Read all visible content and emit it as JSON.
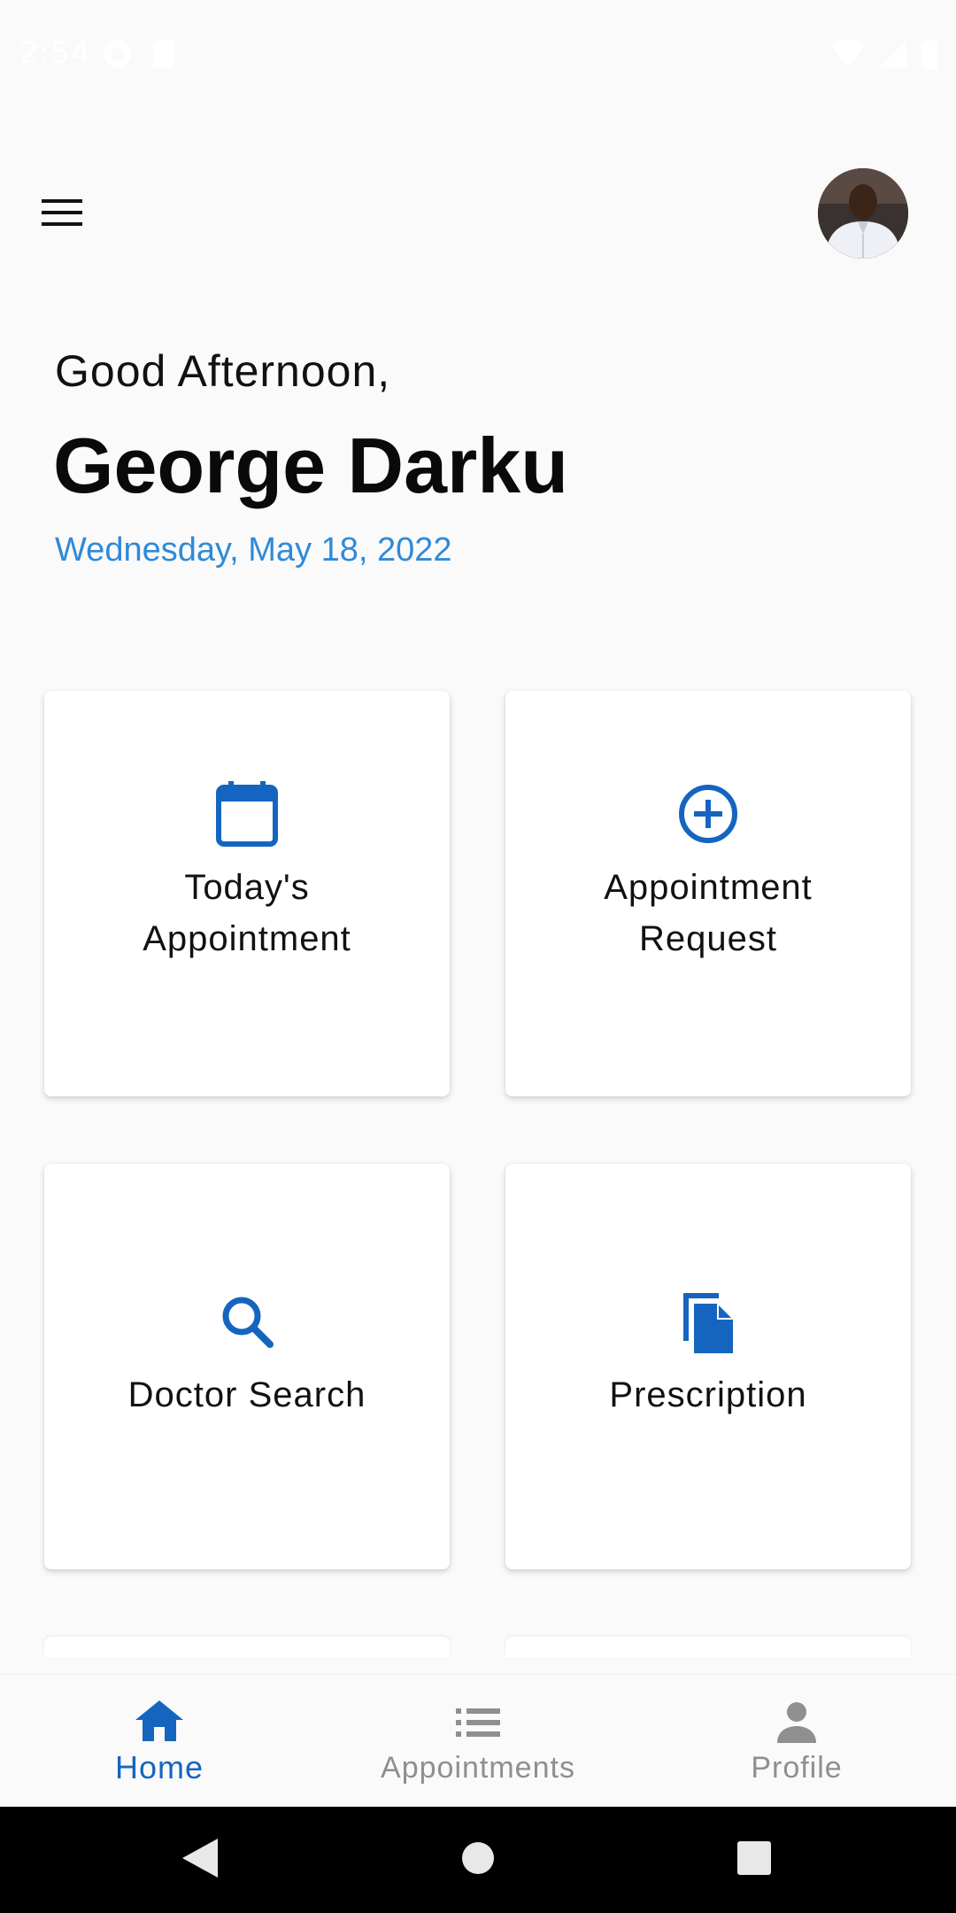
{
  "status_bar": {
    "time": "2:54"
  },
  "header": {
    "menu_icon": "hamburger-menu-icon",
    "avatar_alt": "User profile photo"
  },
  "greeting": {
    "salutation": "Good Afternoon,",
    "name": "George Darku",
    "date": "Wednesday, May 18, 2022"
  },
  "cards": [
    {
      "label": "Today's Appointment",
      "icon": "calendar-icon"
    },
    {
      "label": "Appointment Request",
      "icon": "add-circle-icon"
    },
    {
      "label": "Doctor Search",
      "icon": "search-icon"
    },
    {
      "label": "Prescription",
      "icon": "file-copy-icon"
    }
  ],
  "bottom_nav": {
    "items": [
      {
        "label": "Home",
        "icon": "home-icon",
        "active": true
      },
      {
        "label": "Appointments",
        "icon": "list-icon",
        "active": false
      },
      {
        "label": "Profile",
        "icon": "person-icon",
        "active": false
      }
    ]
  },
  "colors": {
    "primary": "#1565c0",
    "date_accent": "#2f8ad8",
    "inactive_nav": "#8f8f8f",
    "background": "#fafafa"
  }
}
